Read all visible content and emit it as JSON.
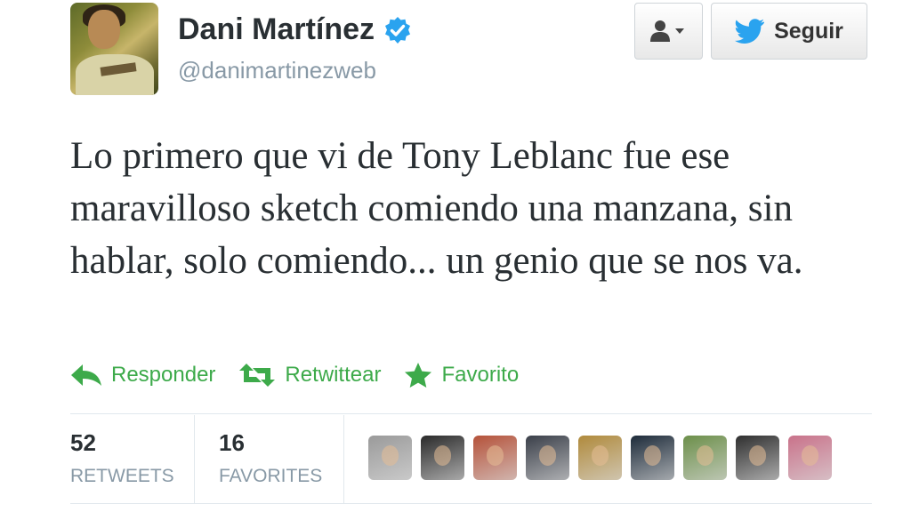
{
  "user": {
    "name": "Dani Martínez",
    "handle": "@danimartinezweb"
  },
  "header": {
    "follow_label": "Seguir"
  },
  "tweet": {
    "text": "Lo primero que vi de Tony Leblanc fue ese maravilloso sketch comiendo una manzana, sin hablar, solo comiendo... un genio que se nos va."
  },
  "actions": {
    "reply_label": "Responder",
    "retweet_label": "Retwittear",
    "favorite_label": "Favorito"
  },
  "stats": {
    "retweets_count": "52",
    "retweets_label": "RETWEETS",
    "favorites_count": "16",
    "favorites_label": "FAVORITES"
  },
  "colors": {
    "action_green": "#3daa4a",
    "verified_blue": "#2aa3ef",
    "twitter_blue": "#2aa3ef",
    "muted_gray": "#8899a6"
  },
  "favoriters": [
    {
      "name": "favoriter-avatar-1",
      "color": "#9a9a9a"
    },
    {
      "name": "favoriter-avatar-2",
      "color": "#2a2a2a"
    },
    {
      "name": "favoriter-avatar-3",
      "color": "#b5523a"
    },
    {
      "name": "favoriter-avatar-4",
      "color": "#3a3f49"
    },
    {
      "name": "favoriter-avatar-5",
      "color": "#b08a3c"
    },
    {
      "name": "favoriter-avatar-6",
      "color": "#1d2b3a"
    },
    {
      "name": "favoriter-avatar-7",
      "color": "#6c8f4a"
    },
    {
      "name": "favoriter-avatar-8",
      "color": "#2f2f2f"
    },
    {
      "name": "favoriter-avatar-9",
      "color": "#c9728a"
    }
  ]
}
